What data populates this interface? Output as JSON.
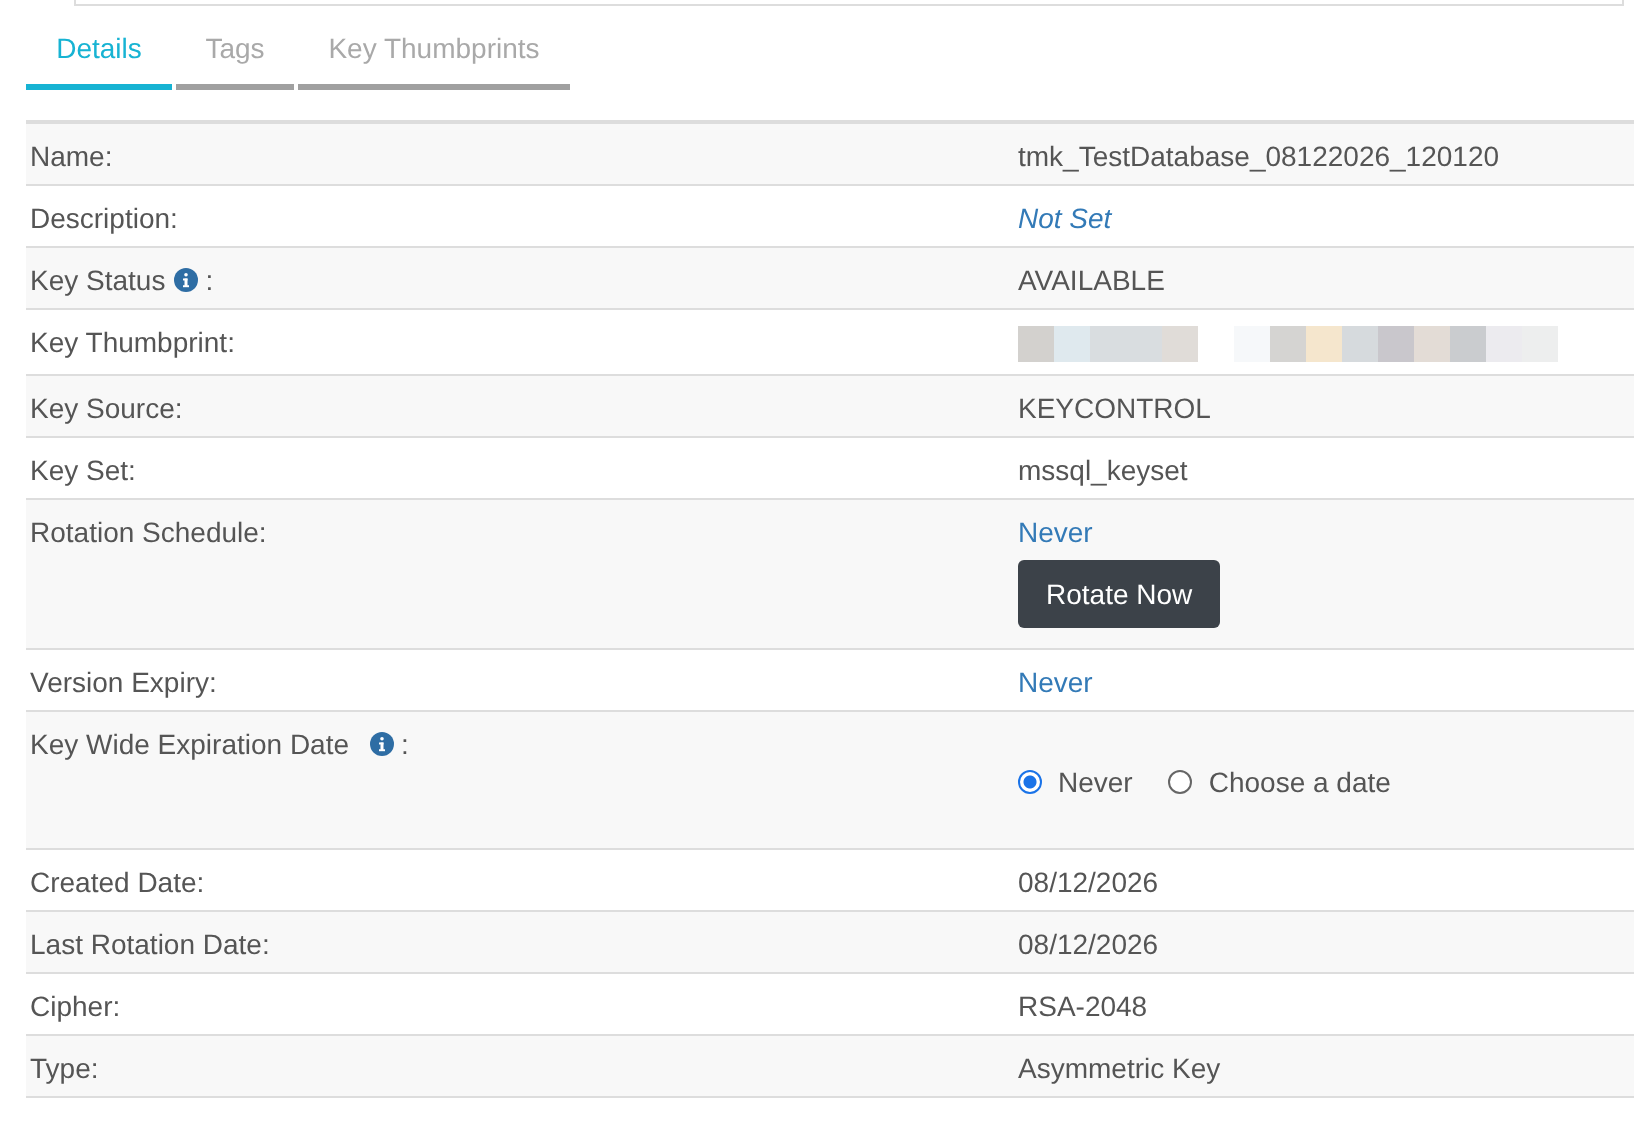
{
  "tabs": [
    {
      "label": "Details",
      "selected": true
    },
    {
      "label": "Tags",
      "selected": false
    },
    {
      "label": "Key Thumbprints",
      "selected": false
    }
  ],
  "rows": [
    {
      "kind": "text",
      "label": "Name:",
      "value": "tmk_TestDatabase_08122026_120120"
    },
    {
      "kind": "empty",
      "label": "Description:",
      "value": "Not Set"
    },
    {
      "kind": "text",
      "label": "Key Status",
      "info": true,
      "suffix": ":",
      "value": "AVAILABLE"
    },
    {
      "kind": "redacted",
      "label": "Key Thumbprint:"
    },
    {
      "kind": "text",
      "label": "Key Source:",
      "value": "KEYCONTROL"
    },
    {
      "kind": "text",
      "label": "Key Set:",
      "value": "mssql_keyset"
    },
    {
      "kind": "schedule",
      "label": "Rotation Schedule:",
      "value": "Never",
      "button": "Rotate Now"
    },
    {
      "kind": "link",
      "label": "Version Expiry:",
      "value": "Never"
    },
    {
      "kind": "radio",
      "label": "Key Wide Expiration Date",
      "info": true,
      "suffix": ":",
      "options": [
        {
          "label": "Never",
          "selected": true
        },
        {
          "label": "Choose a date",
          "selected": false
        }
      ]
    },
    {
      "kind": "text",
      "label": "Created Date:",
      "value": "08/12/2026"
    },
    {
      "kind": "text",
      "label": "Last Rotation Date:",
      "value": "08/12/2026"
    },
    {
      "kind": "text",
      "label": "Cipher:",
      "value": "RSA-2048"
    },
    {
      "kind": "text",
      "label": "Type:",
      "value": "Asymmetric Key"
    }
  ]
}
